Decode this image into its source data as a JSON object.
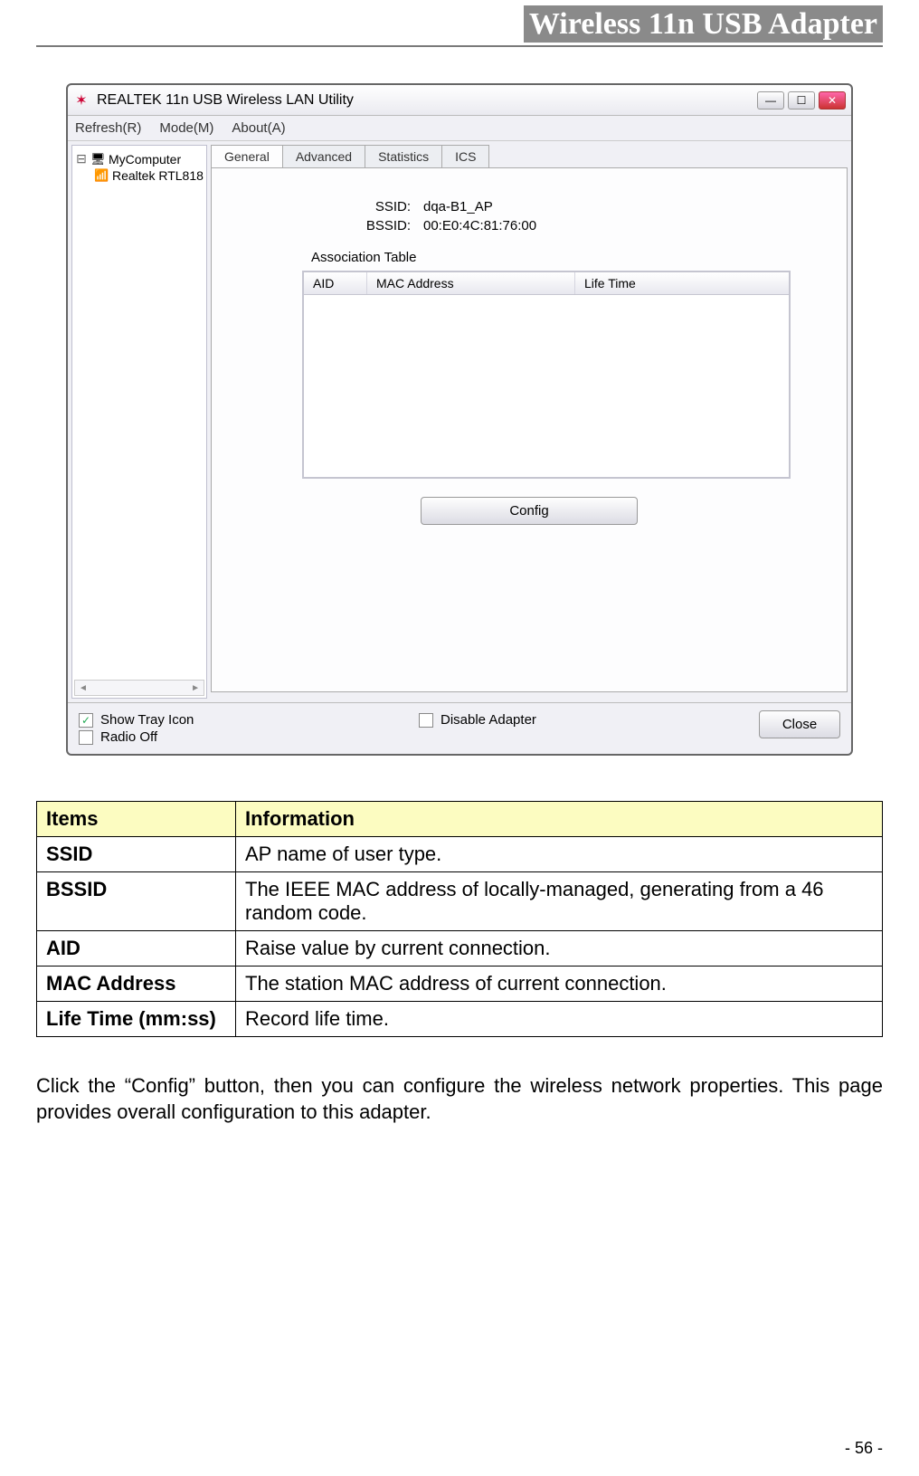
{
  "header": {
    "title": "Wireless 11n USB Adapter"
  },
  "window": {
    "title": "REALTEK 11n USB Wireless LAN Utility",
    "menus": [
      "Refresh(R)",
      "Mode(M)",
      "About(A)"
    ],
    "tree": {
      "root": "MyComputer",
      "child": "Realtek RTL818"
    },
    "tabs": [
      "General",
      "Advanced",
      "Statistics",
      "ICS"
    ],
    "activeTab": 0,
    "general": {
      "ssidLabel": "SSID:",
      "ssidValue": "dqa-B1_AP",
      "bssidLabel": "BSSID:",
      "bssidValue": "00:E0:4C:81:76:00",
      "assocLabel": "Association Table",
      "cols": [
        "AID",
        "MAC Address",
        "Life Time"
      ],
      "configBtn": "Config"
    },
    "bottom": {
      "showTray": "Show Tray Icon",
      "radioOff": "Radio Off",
      "disableAdapter": "Disable Adapter",
      "closeBtn": "Close"
    },
    "scrollHint": "…"
  },
  "infoTable": {
    "head": [
      "Items",
      "Information"
    ],
    "rows": [
      [
        "SSID",
        "AP name of user type."
      ],
      [
        "BSSID",
        "The IEEE MAC address of locally-managed, generating from a 46 random code."
      ],
      [
        "AID",
        "Raise value by current connection."
      ],
      [
        "MAC Address",
        "The station MAC address of current connection."
      ],
      [
        "Life Time (mm:ss)",
        "Record life time."
      ]
    ]
  },
  "paragraph": "Click the “Config” button, then you can configure the wireless network properties. This page provides overall configuration to this adapter.",
  "pageNumber": "- 56 -"
}
